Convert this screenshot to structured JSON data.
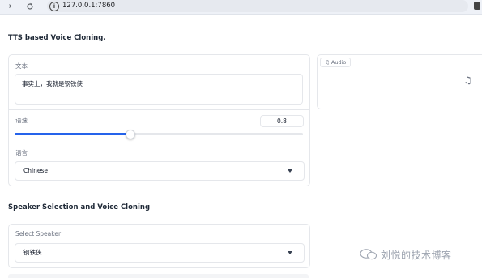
{
  "browser": {
    "url": "127.0.0.1:7860",
    "back_icon": "arrow-right-icon",
    "reload_icon": "reload-icon"
  },
  "page": {
    "title": "TTS based Voice Cloning."
  },
  "text_input": {
    "label": "文本",
    "value": "事实上，我就是钢铁侠"
  },
  "speed": {
    "label": "语速",
    "value": "0.8",
    "fraction": 0.4
  },
  "language": {
    "label": "语言",
    "selected": "Chinese"
  },
  "audio": {
    "label": "Audio",
    "icon": "music-note-icon"
  },
  "speaker_section": {
    "title": "Speaker Selection and Voice Cloning",
    "select_label": "Select Speaker",
    "selected": "钢铁侠"
  },
  "watermark": {
    "text": "刘悦的技术博客"
  }
}
